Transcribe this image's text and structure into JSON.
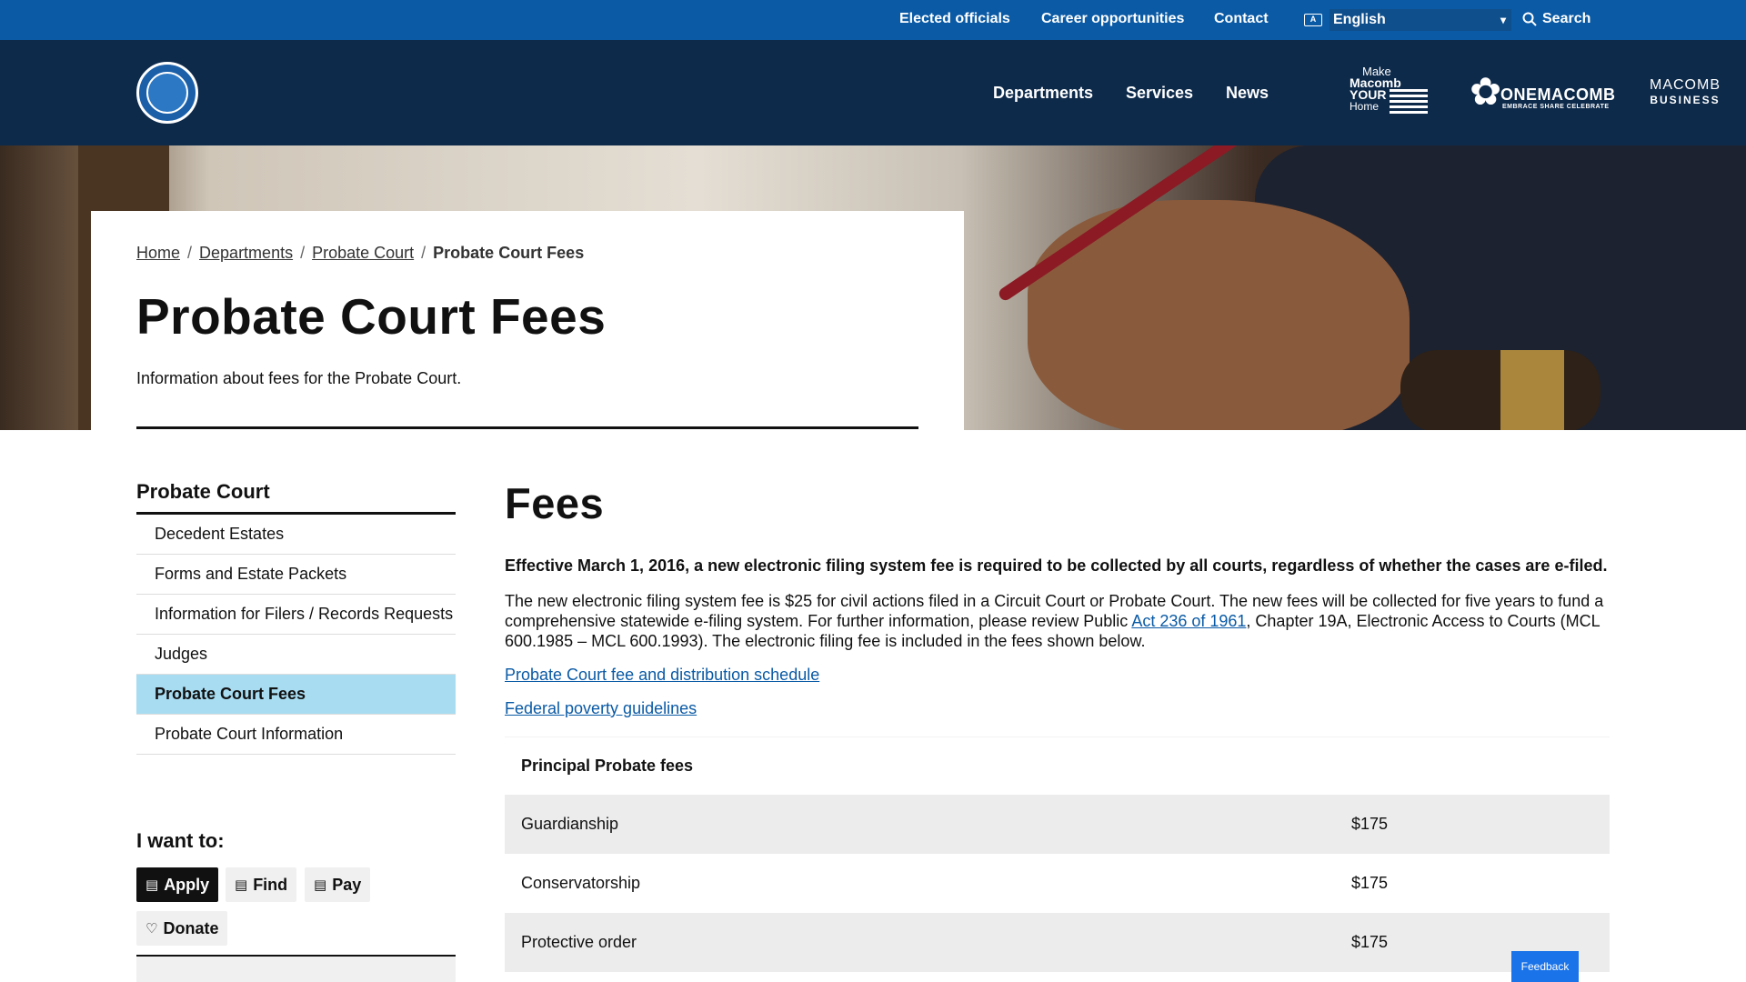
{
  "utility_nav": {
    "elected_officials": "Elected officials",
    "career_opportunities": "Career opportunities",
    "contact": "Contact",
    "language_selected": "English",
    "search": "Search"
  },
  "main_nav": {
    "departments": "Departments",
    "services": "Services",
    "news": "News"
  },
  "brands": {
    "make_line1": "Make",
    "make_line2": "Macomb",
    "make_line3": "YOUR",
    "make_line4": "Home",
    "one_macomb": "ONEMACOMB",
    "one_macomb_tagline": "EMBRACE SHARE CELEBRATE",
    "biz_line1": "MACOMB",
    "biz_line2": "BUSINESS"
  },
  "breadcrumb": {
    "home": "Home",
    "departments": "Departments",
    "probate_court": "Probate Court",
    "current": "Probate Court Fees"
  },
  "page": {
    "title": "Probate Court Fees",
    "description": "Information about fees for the Probate Court."
  },
  "sidebar": {
    "heading": "Probate Court",
    "items": [
      {
        "label": "Decedent Estates"
      },
      {
        "label": "Forms and Estate Packets"
      },
      {
        "label": "Information for Filers / Records Requests"
      },
      {
        "label": "Judges"
      },
      {
        "label": "Probate Court Fees"
      },
      {
        "label": "Probate Court Information"
      }
    ],
    "active_index": 4
  },
  "i_want_to": {
    "heading": "I want to:",
    "apply": "Apply",
    "find": "Find",
    "pay": "Pay",
    "donate": "Donate"
  },
  "content": {
    "heading": "Fees",
    "lead": "Effective March 1, 2016, a new electronic filing system fee is required to be collected by all courts, regardless of whether the cases are e-filed.",
    "para_before_link": "The new electronic filing system fee is $25 for civil actions filed in a Circuit Court or Probate Court.  The new fees will be collected for five years to fund a comprehensive statewide e-filing system.  For further information, please review Public ",
    "para_link": "Act 236 of 1961",
    "para_after_link": ", Chapter 19A, Electronic Access to Courts (MCL 600.1985 – MCL 600.1993). The electronic filing fee is included in the fees shown below.",
    "link_schedule": "Probate Court fee and distribution schedule",
    "link_poverty": "Federal poverty guidelines"
  },
  "fee_table": {
    "heading": "Principal Probate fees",
    "rows": [
      {
        "name": "Guardianship",
        "amount": "$175"
      },
      {
        "name": "Conservatorship",
        "amount": "$175"
      },
      {
        "name": "Protective order",
        "amount": "$175"
      }
    ]
  },
  "feedback": "Feedback",
  "colors": {
    "utility_bar": "#0a5aa5",
    "header": "#0d2a4b",
    "active_sidebar": "#a8dcf1",
    "link": "#0a5aa5",
    "feedback": "#1a73e8"
  }
}
